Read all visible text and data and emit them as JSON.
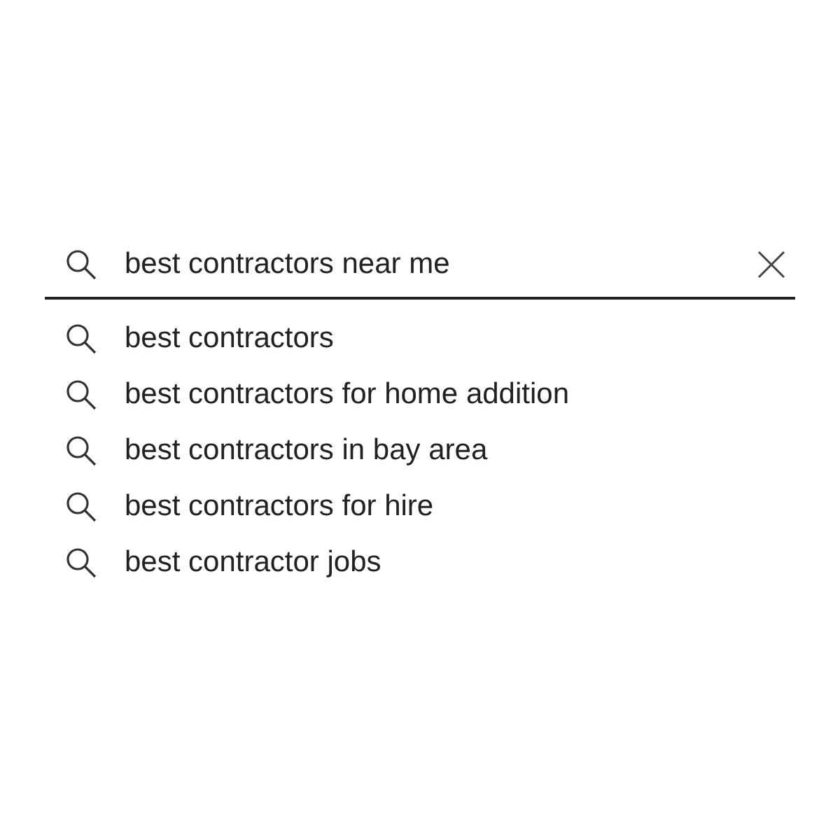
{
  "search": {
    "value": "best contractors near me"
  },
  "suggestions": [
    "best contractors",
    "best contractors for home addition",
    "best contractors in bay area",
    "best contractors for hire",
    "best contractor jobs"
  ]
}
